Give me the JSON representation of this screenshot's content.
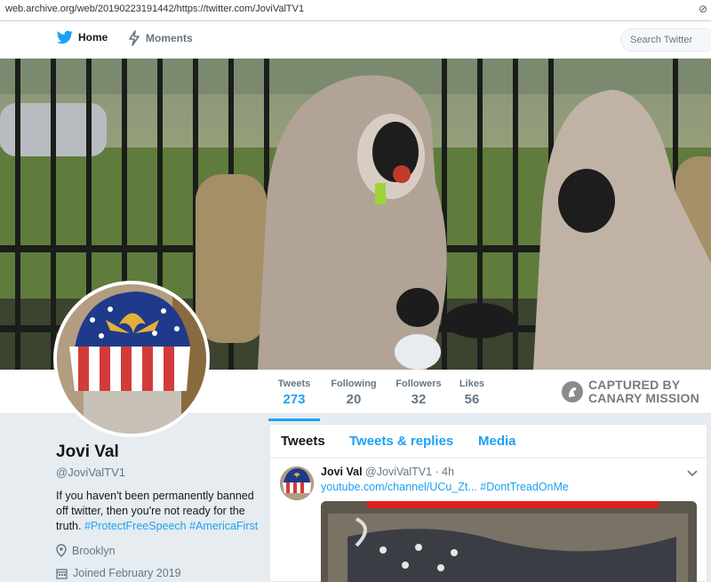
{
  "browser": {
    "url": "web.archive.org/web/20190223191442/https://twitter.com/JoviValTV1"
  },
  "nav": {
    "home_label": "Home",
    "moments_label": "Moments",
    "search_placeholder": "Search Twitter"
  },
  "stats": {
    "tweets_label": "Tweets",
    "tweets_value": "273",
    "following_label": "Following",
    "following_value": "20",
    "followers_label": "Followers",
    "followers_value": "32",
    "likes_label": "Likes",
    "likes_value": "56"
  },
  "watermark": {
    "line1": "CAPTURED BY",
    "line2": "CANARY MISSION"
  },
  "profile": {
    "name": "Jovi Val",
    "handle": "@JoviValTV1",
    "bio_text": "If you haven't been permanently banned off twitter, then you're not ready for the truth.",
    "bio_hashtag1": "#ProtectFreeSpeech",
    "bio_hashtag2": "#AmericaFirst",
    "location": "Brooklyn",
    "joined": "Joined February 2019"
  },
  "timeline": {
    "tab_tweets": "Tweets",
    "tab_replies": "Tweets & replies",
    "tab_media": "Media",
    "tweet": {
      "name": "Jovi Val",
      "handle": "@JoviValTV1",
      "time": "· 4h",
      "link": "youtube.com/channel/UCu_Zt...",
      "hashtag": "#DontTreadOnMe"
    }
  },
  "colors": {
    "accent": "#1da1f2",
    "text": "#14171a",
    "muted": "#657786",
    "background": "#e6ecf0"
  },
  "icons": [
    "twitter-bird-icon",
    "moments-bolt-icon",
    "location-pin-icon",
    "calendar-icon",
    "chevron-down-icon",
    "canary-logo-icon"
  ]
}
